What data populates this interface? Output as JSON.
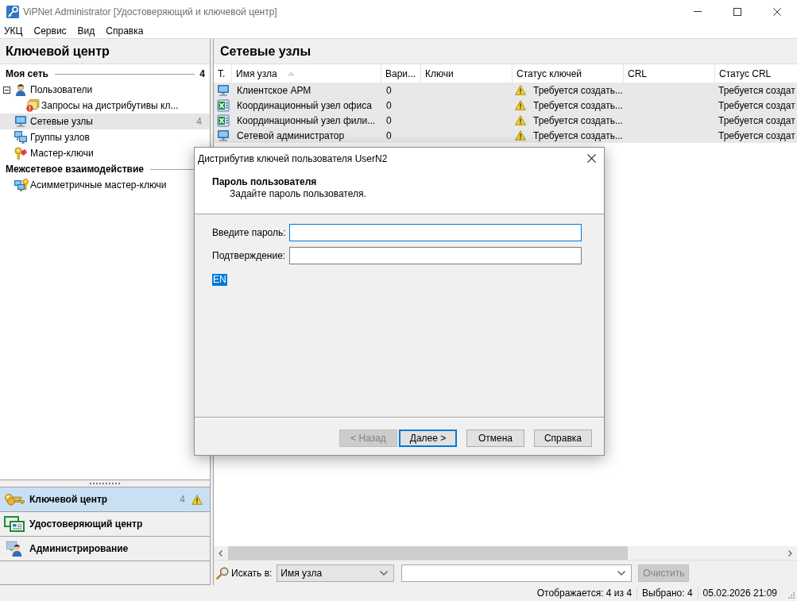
{
  "window": {
    "title": "ViPNet Administrator [Удостоверяющий и ключевой центр]"
  },
  "menu": [
    "УКЦ",
    "Сервис",
    "Вид",
    "Справка"
  ],
  "left_panel": {
    "title": "Ключевой центр",
    "sections": [
      {
        "title": "Моя сеть",
        "count": "4",
        "items": [
          {
            "kind": "users",
            "label": "Пользователи",
            "selected": false,
            "expanded": true,
            "children": [
              {
                "kind": "requests",
                "label": "Запросы на дистрибутивы кл...",
                "selected": false
              }
            ]
          },
          {
            "kind": "nodes",
            "label": "Сетевые узлы",
            "count": "4",
            "selected": true
          },
          {
            "kind": "groups",
            "label": "Группы узлов",
            "selected": false
          },
          {
            "kind": "masterkeys",
            "label": "Мастер-ключи",
            "selected": false
          }
        ]
      },
      {
        "title": "Межсетевое взаимодействие",
        "items": [
          {
            "kind": "asymkeys",
            "label": "Асимметричные мастер-ключи",
            "selected": false
          }
        ]
      }
    ],
    "navigation": [
      {
        "kind": "keys",
        "label": "Ключевой центр",
        "selected": true,
        "count": "4",
        "warning": true
      },
      {
        "kind": "certs",
        "label": "Удостоверяющий центр",
        "selected": false,
        "warning": false
      },
      {
        "kind": "admin",
        "label": "Администрирование",
        "selected": false,
        "warning": false
      }
    ]
  },
  "right_panel": {
    "title": "Сетевые узлы",
    "table": {
      "columns": [
        {
          "label": "Т.",
          "sorted": false
        },
        {
          "label": "Имя узла",
          "sorted": true
        },
        {
          "label": "Вари...",
          "sorted": false
        },
        {
          "label": "Ключи",
          "sorted": false
        },
        {
          "label": "Статус ключей",
          "sorted": false
        },
        {
          "label": "CRL",
          "sorted": false
        },
        {
          "label": "Статус CRL",
          "sorted": false
        }
      ],
      "rows": [
        {
          "kind": "client",
          "selected": true,
          "name": "Клиентское АРМ",
          "column_3": "0",
          "key_status": "Требуется создать...",
          "crl_status": "Требуется создат"
        },
        {
          "kind": "coordinator",
          "selected": true,
          "name": "Координационный узел офиса",
          "column_3": "0",
          "key_status": "Требуется создать...",
          "crl_status": "Требуется создат"
        },
        {
          "kind": "coordinator",
          "selected": true,
          "name": "Координационный узел фили...",
          "column_3": "0",
          "key_status": "Требуется создать...",
          "crl_status": "Требуется создат"
        },
        {
          "kind": "client",
          "selected": true,
          "name": "Сетевой администратор",
          "column_3": "0",
          "key_status": "Требуется создать...",
          "crl_status": "Требуется создат"
        }
      ]
    },
    "search": {
      "label": "Искать в:",
      "scope": "Имя узла",
      "clear_button": {
        "label": "Очистить",
        "disabled": true
      }
    }
  },
  "status_bar": [
    "Отображается: 4 из 4",
    "Выбрано: 4",
    "05.02.2026 21:09"
  ],
  "dialog": {
    "title": "Дистрибутив ключей пользователя UserN2",
    "heading": "Пароль пользователя",
    "subheading": "Задайте пароль пользователя.",
    "fields": [
      {
        "label": "Введите пароль:",
        "focused": true
      },
      {
        "label": "Подтверждение:",
        "focused": false
      }
    ],
    "keyboard_layout": "EN",
    "buttons": [
      {
        "label": "< Назад",
        "disabled": true,
        "default": false
      },
      {
        "label": "Далее >",
        "disabled": false,
        "default": true
      },
      {
        "label": "Отмена",
        "disabled": false,
        "default": false
      },
      {
        "label": "Справка",
        "disabled": false,
        "default": false
      }
    ]
  }
}
